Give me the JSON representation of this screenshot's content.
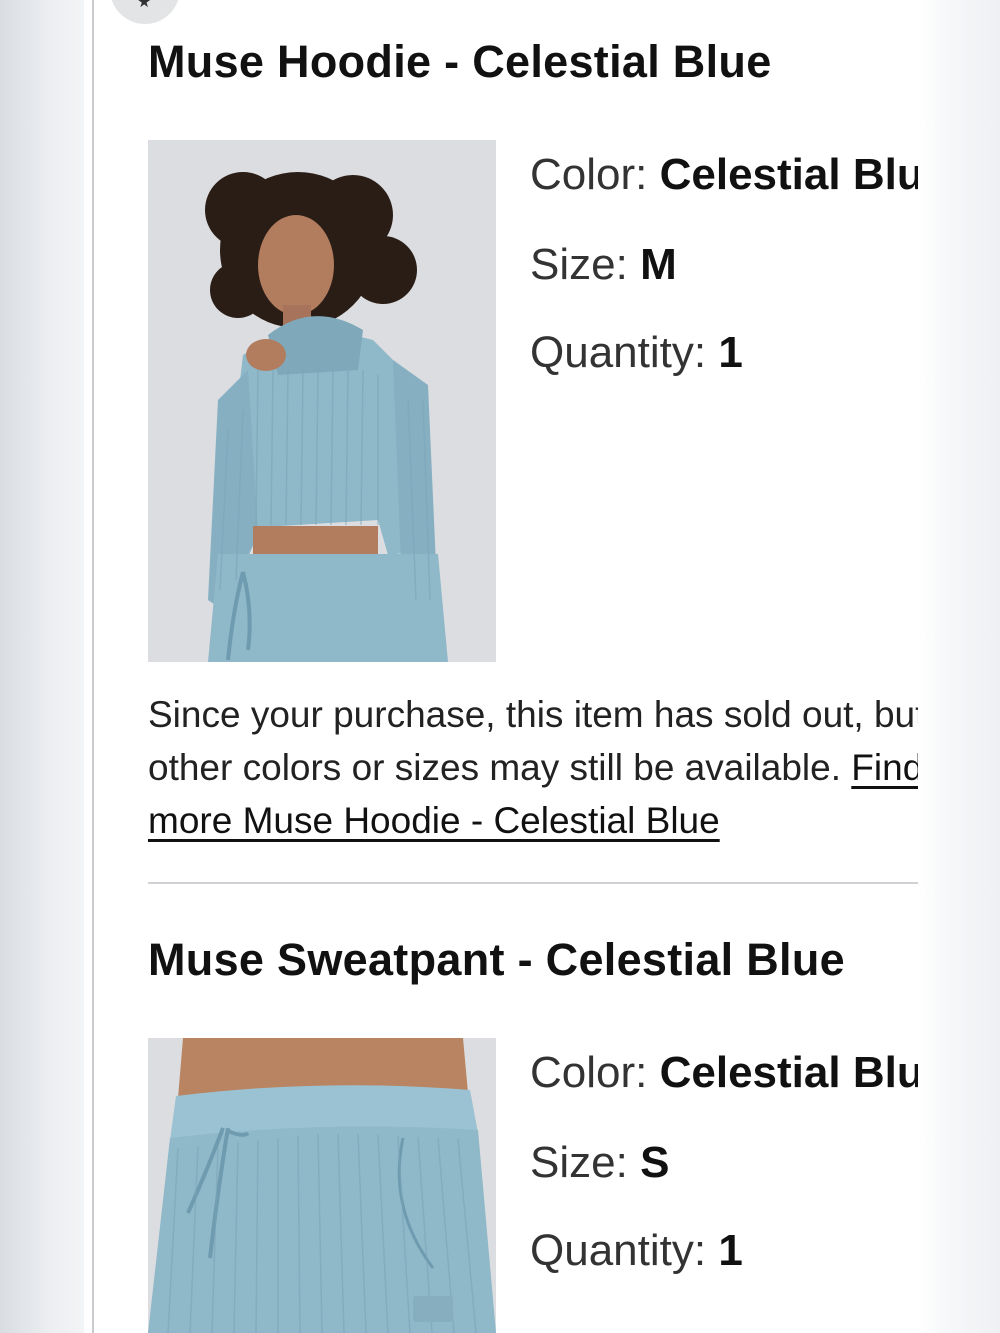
{
  "items": [
    {
      "title": "Muse Hoodie - Celestial Blue",
      "color_label": "Color:",
      "color_value": "Celestial Blue",
      "size_label": "Size:",
      "size_value": "M",
      "qty_label": "Quantity:",
      "qty_value": "1",
      "notice_text": "Since your purchase, this item has sold out, but other colors or sizes may still be available.",
      "notice_link": "Find more Muse Hoodie - Celestial Blue"
    },
    {
      "title": "Muse Sweatpant - Celestial Blue",
      "color_label": "Color:",
      "color_value": "Celestial Blue",
      "size_label": "Size:",
      "size_value": "S",
      "qty_label": "Quantity:",
      "qty_value": "1"
    }
  ],
  "colors": {
    "product": "#8fb8c9",
    "product_shadow": "#6f9bb0",
    "photo_bg": "#dcdde0"
  },
  "icons": [
    "star-icon",
    "hoodie-photo",
    "sweatpant-photo"
  ]
}
